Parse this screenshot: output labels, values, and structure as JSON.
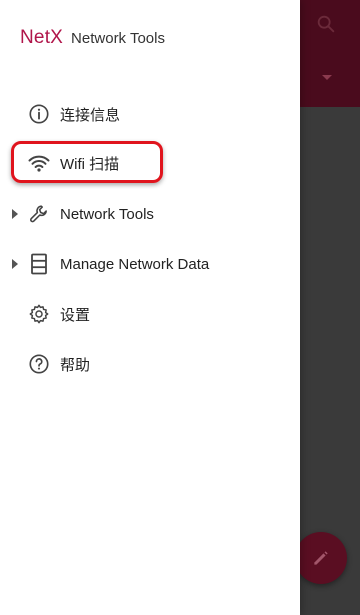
{
  "drawer": {
    "brand": "NetX",
    "subtitle": "Network Tools",
    "items": [
      {
        "label": "连接信息",
        "icon": "info-icon",
        "expandable": false
      },
      {
        "label": "Wifi 扫描",
        "icon": "wifi-icon",
        "expandable": false,
        "highlighted": true
      },
      {
        "label": "Network Tools",
        "icon": "wrench-icon",
        "expandable": true
      },
      {
        "label": "Manage Network Data",
        "icon": "storage-icon",
        "expandable": true
      },
      {
        "label": "设置",
        "icon": "gear-icon",
        "expandable": false
      },
      {
        "label": "帮助",
        "icon": "help-icon",
        "expandable": false
      }
    ]
  },
  "background": {
    "actions": [
      "search-icon",
      "dropdown-arrow-icon",
      "edit-icon"
    ]
  },
  "colors": {
    "brand": "#b0154a",
    "highlight": "#e0141d",
    "appbar": "#4a0b1d",
    "fab": "#5a0e22"
  }
}
